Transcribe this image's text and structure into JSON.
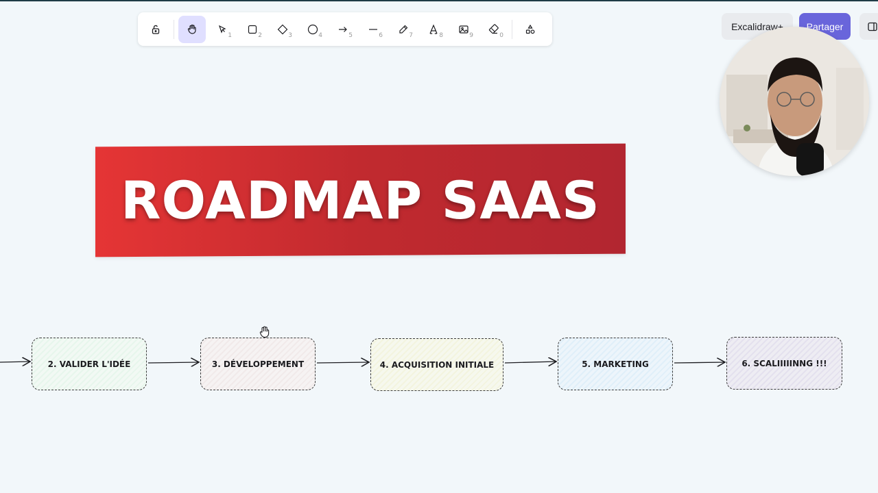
{
  "toolbar": {
    "tools": [
      {
        "name": "lock-icon",
        "num": ""
      },
      {
        "name": "hand-icon",
        "num": ""
      },
      {
        "name": "selection-icon",
        "num": "1"
      },
      {
        "name": "rectangle-icon",
        "num": "2"
      },
      {
        "name": "diamond-icon",
        "num": "3"
      },
      {
        "name": "ellipse-icon",
        "num": "4"
      },
      {
        "name": "arrow-icon",
        "num": "5"
      },
      {
        "name": "line-icon",
        "num": "6"
      },
      {
        "name": "pencil-icon",
        "num": "7"
      },
      {
        "name": "text-icon",
        "num": "8"
      },
      {
        "name": "image-icon",
        "num": "9"
      },
      {
        "name": "eraser-icon",
        "num": "0"
      },
      {
        "name": "shapes-library-icon",
        "num": ""
      }
    ],
    "active_tool": "hand"
  },
  "header": {
    "excalidraw_label": "Excalidraw+",
    "share_label": "Partager"
  },
  "banner": {
    "title": "ROADMAP SAAS",
    "color": "#d52f33"
  },
  "steps": [
    {
      "label": "2. VALIDER L'IDÉE"
    },
    {
      "label": "3. DÉVELOPPEMENT"
    },
    {
      "label": "4. ACQUISITION INITIALE"
    },
    {
      "label": "5. MARKETING"
    },
    {
      "label": "6. SCALIIIIINNG !!!"
    }
  ],
  "colors": {
    "accent": "#6965db",
    "canvas": "#f2f7fa"
  }
}
